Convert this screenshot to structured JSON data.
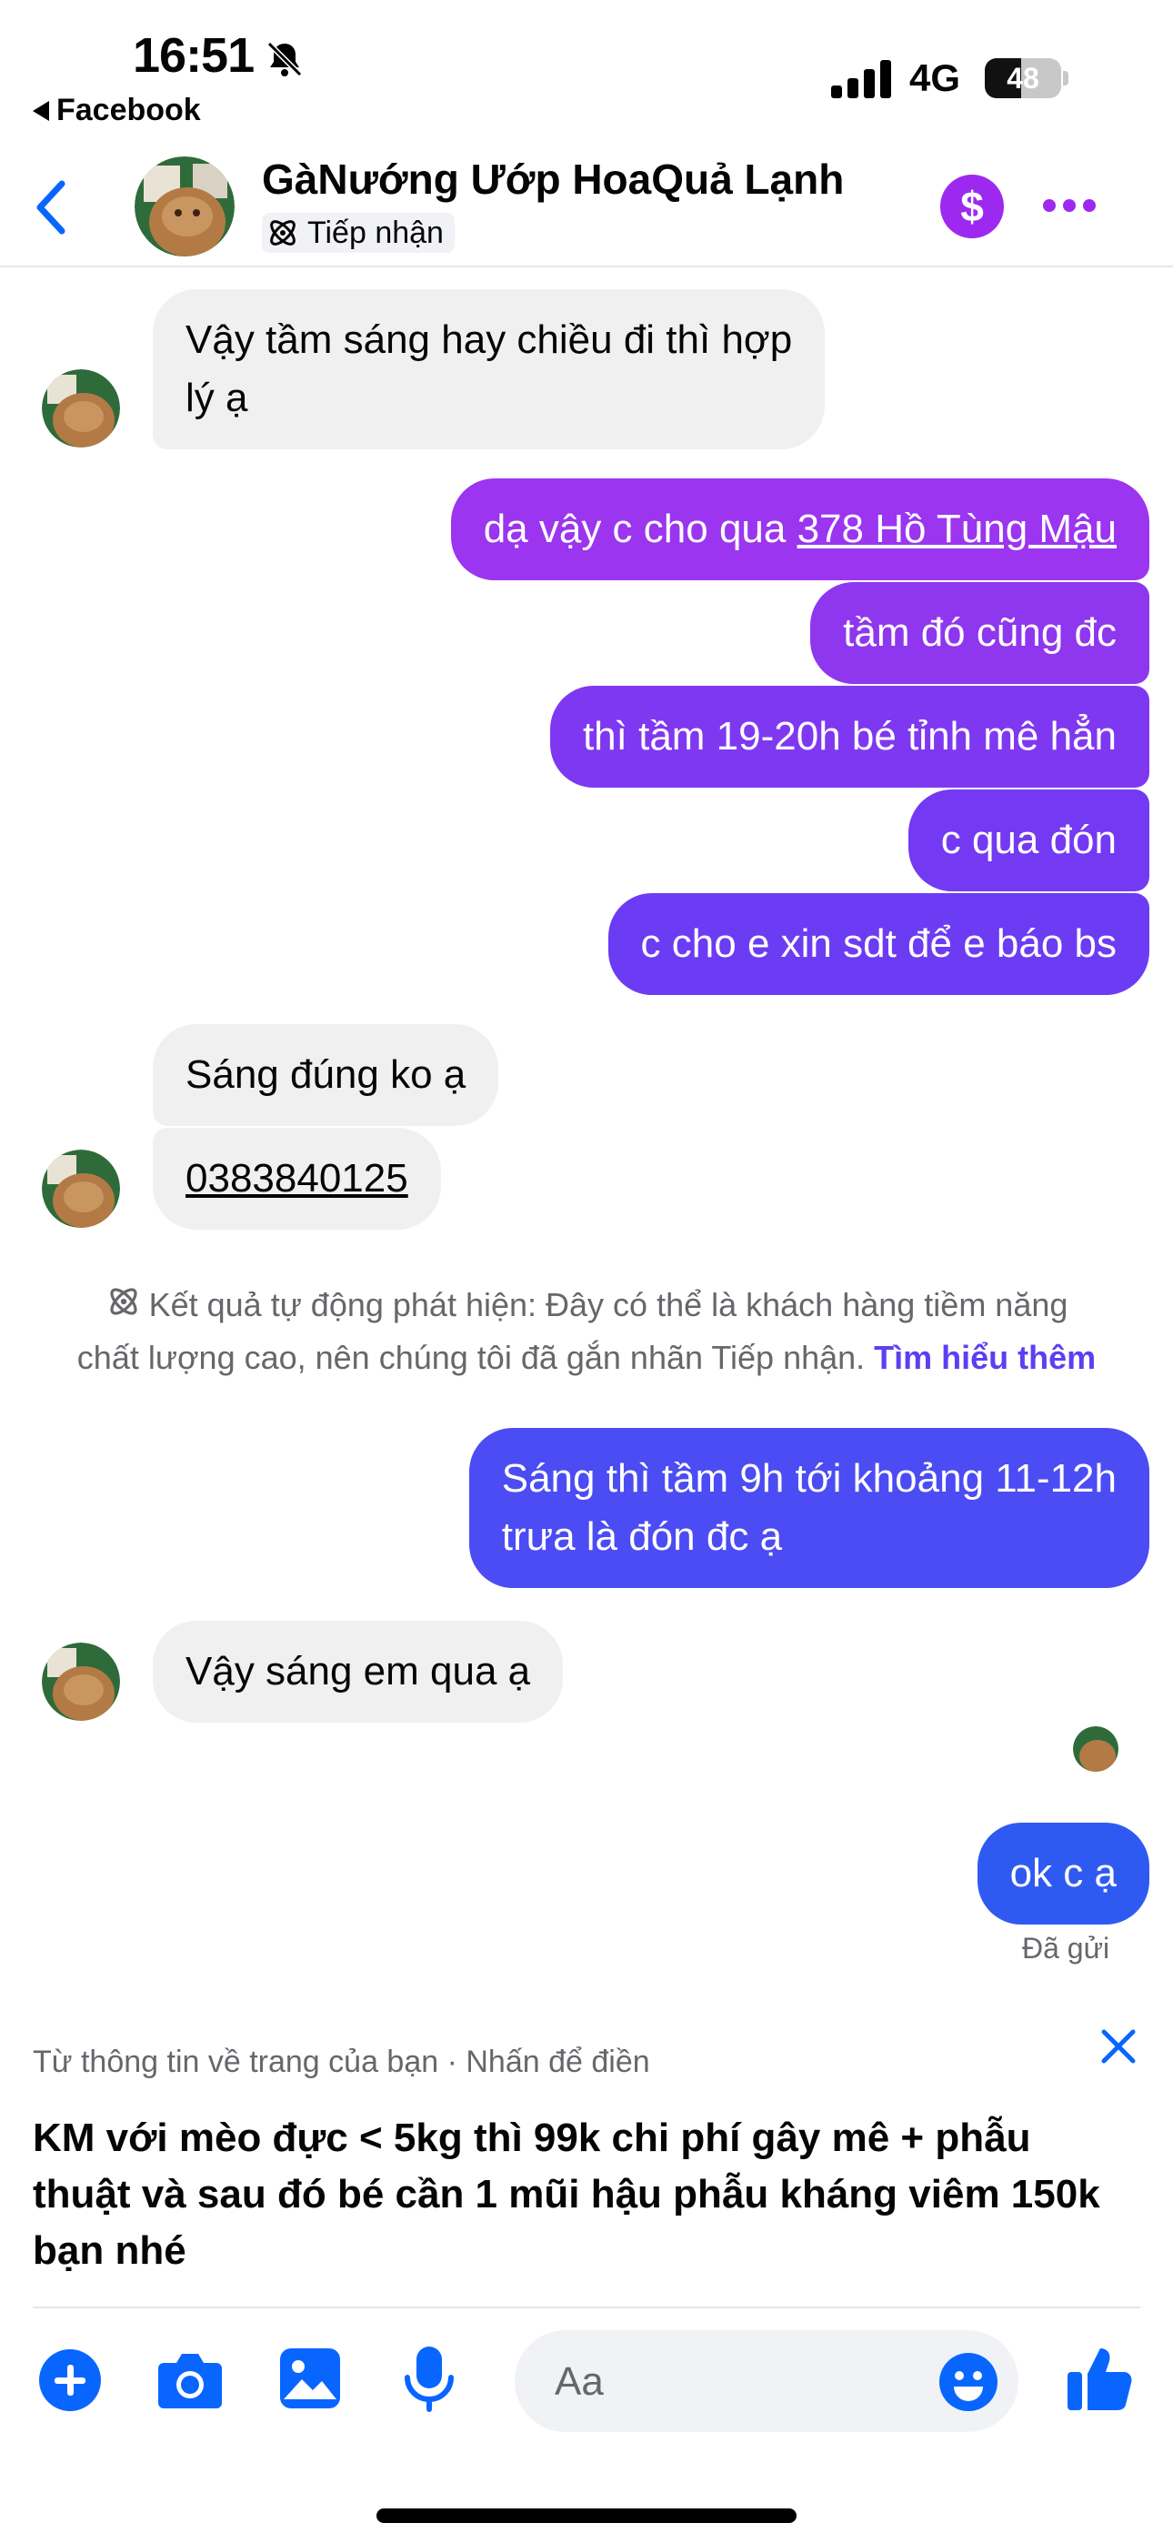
{
  "status": {
    "time": "16:51",
    "back_app": "Facebook",
    "network": "4G",
    "battery": "48",
    "battery_level": 0.48
  },
  "header": {
    "name": "GàNướng Ướp HoaQuả Lạnh",
    "tag": "Tiếp nhận",
    "dollar": "$"
  },
  "messages": {
    "m1": [
      "Vậy tầm sáng hay chiều đi thì hợp",
      "lý ạ"
    ],
    "m2_prefix": "dạ vậy c cho qua ",
    "m2_link": "378 Hồ Tùng Mậu",
    "m3": "tầm đó cũng đc",
    "m4": "thì tầm 19-20h bé tỉnh mê hẳn",
    "m5": "c qua đón",
    "m6": "c cho e xin sdt để e báo bs",
    "m7": "Sáng đúng ko ạ",
    "m8": "0383840125",
    "m9": [
      "Sáng thì tầm 9h tới khoảng 11-12h",
      "trưa là đón đc ạ"
    ],
    "m10": "Vậy sáng em qua ạ",
    "m11": "ok c ạ"
  },
  "system_note": {
    "line1": "Kết quả tự động phát hiện: Đây có thể là khách hàng tiềm năng",
    "line2": "chất lượng cao, nên chúng tôi đã gắn nhãn Tiếp nhận. ",
    "learn_more": "Tìm hiểu thêm"
  },
  "sent_status": "Đã gửi",
  "suggestion": {
    "meta": "Từ thông tin về trang của bạn · Nhấn để điền",
    "text": "KM với mèo đực < 5kg thì 99k chi phí gây mê + phẫu thuật và sau đó bé cần 1 mũi hậu phẫu kháng viêm 150k bạn nhé"
  },
  "composer": {
    "placeholder": "Aa"
  },
  "icons": [
    "bell-muted-icon",
    "signal-icon",
    "battery-icon",
    "back-chevron-icon",
    "tag-icon",
    "dollar-icon",
    "more-icon",
    "close-icon",
    "add-icon",
    "camera-icon",
    "gallery-icon",
    "mic-icon",
    "emoji-icon",
    "like-icon"
  ],
  "colors": {
    "accent": "#0866ff",
    "out_top": "#9b35ef",
    "out_mid": "#6b3cf3",
    "out_bottom": "#2f5af2",
    "incoming": "#f0f0f0",
    "dollar": "#9d29f0"
  }
}
